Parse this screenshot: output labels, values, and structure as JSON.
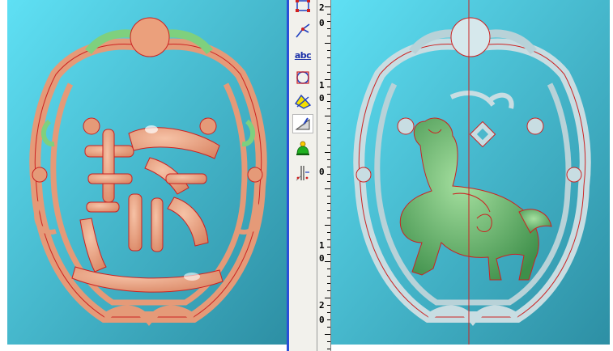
{
  "viewports": {
    "left": {
      "background_top": "#5fe0f4",
      "background_bottom": "#2d8fa4",
      "relief_color": "#e59a78",
      "highlight_color": "#7fd07e",
      "outline_color": "#cc2222"
    },
    "right": {
      "background_top": "#5fe0f4",
      "background_bottom": "#2d8fa4",
      "relief_color": "#c8dde2",
      "creature_color": "#5cae62",
      "outline_color": "#cc2222"
    }
  },
  "toolbar": {
    "tools": [
      {
        "name": "bounding-box-icon"
      },
      {
        "name": "vector-pick-icon"
      },
      {
        "name": "text-tool-icon",
        "label": "abc"
      },
      {
        "name": "node-edit-icon"
      },
      {
        "name": "trim-curve-icon"
      },
      {
        "name": "sculpt-tool-icon"
      },
      {
        "name": "bell-project-icon"
      },
      {
        "name": "cut-plane-icon"
      }
    ]
  },
  "ruler": {
    "labels": [
      {
        "digits": [
          "2",
          "0"
        ]
      },
      {
        "digits": [
          "1",
          "0"
        ]
      },
      {
        "digits": [
          "0"
        ]
      },
      {
        "digits": [
          "1",
          "0"
        ]
      },
      {
        "digits": [
          "2",
          "0"
        ]
      }
    ]
  }
}
